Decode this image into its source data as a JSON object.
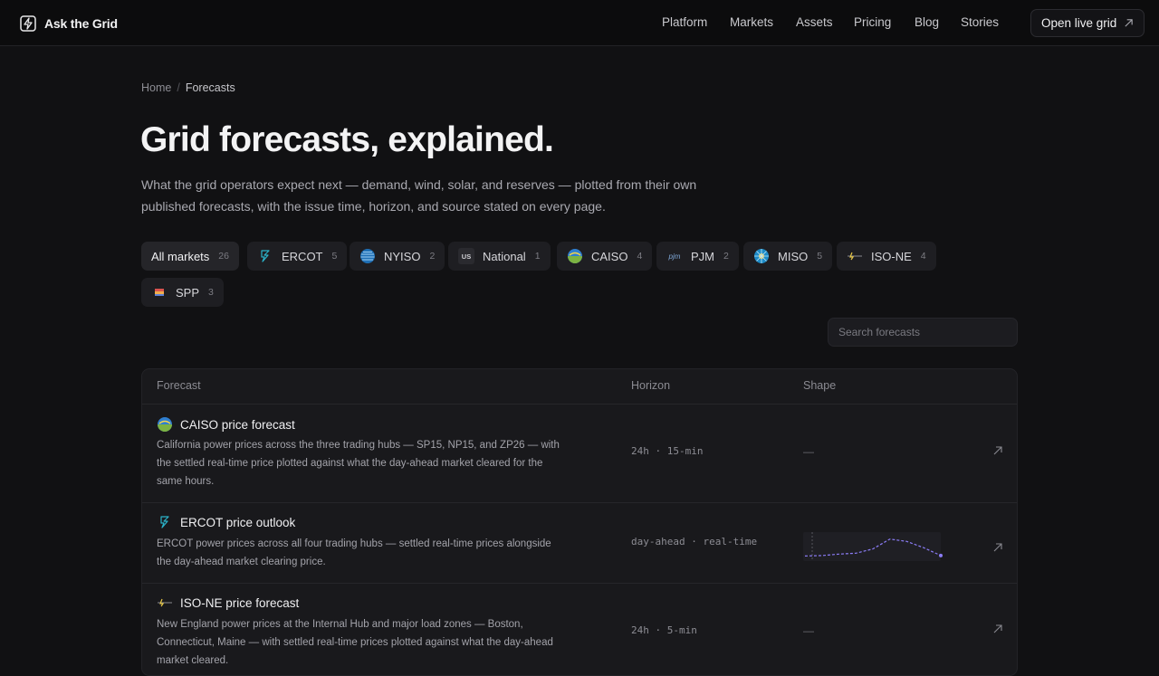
{
  "brand": {
    "name": "Ask the Grid",
    "logo_icon": "bolt-slash-logo-icon"
  },
  "nav": {
    "items": [
      "Platform",
      "Markets",
      "Assets",
      "Pricing",
      "Blog",
      "Stories"
    ],
    "cta_label": "Open live grid",
    "cta_icon": "arrow-up-right-icon"
  },
  "breadcrumb": {
    "home": "Home",
    "separator": "/",
    "current": "Forecasts"
  },
  "hero": {
    "title": "Grid forecasts, explained.",
    "subtitle": "What the grid operators expect next — demand, wind, solar, and reserves — plotted from their own published forecasts, with the issue time, horizon, and source stated on every page."
  },
  "filters": [
    {
      "label": "All markets",
      "count": "26",
      "icon": "",
      "active": true
    },
    {
      "label": "ERCOT",
      "count": "5",
      "icon": "ercot-icon"
    },
    {
      "label": "NYISO",
      "count": "2",
      "icon": "nyiso-icon"
    },
    {
      "label": "National",
      "count": "1",
      "icon": "us-flag-icon",
      "icon_text": "US"
    },
    {
      "label": "CAISO",
      "count": "4",
      "icon": "caiso-icon"
    },
    {
      "label": "PJM",
      "count": "2",
      "icon": "pjm-icon",
      "icon_text": "pjm"
    },
    {
      "label": "MISO",
      "count": "5",
      "icon": "miso-icon"
    },
    {
      "label": "ISO-NE",
      "count": "4",
      "icon": "isone-icon"
    },
    {
      "label": "SPP",
      "count": "3",
      "icon": "spp-icon"
    }
  ],
  "search": {
    "placeholder": "Search forecasts",
    "value": ""
  },
  "table": {
    "columns": [
      "Forecast",
      "Horizon",
      "Shape"
    ],
    "rows": [
      {
        "title": "CAISO price forecast",
        "icon": "caiso-icon",
        "description": "California power prices across the three trading hubs — SP15, NP15, and ZP26 — with the settled real-time price plotted against what the day-ahead market cleared for the same hours.",
        "horizon": "24h · 15-min",
        "shape": "—"
      },
      {
        "title": "ERCOT price outlook",
        "icon": "ercot-icon",
        "description": "ERCOT power prices across all four trading hubs — settled real-time prices alongside the day-ahead market clearing price.",
        "horizon": "day-ahead · real-time",
        "shape": "sparkline",
        "shape_points": [
          0.1,
          0.12,
          0.18,
          0.22,
          0.4,
          0.82,
          0.72,
          0.45,
          0.12
        ]
      },
      {
        "title": "ISO-NE price forecast",
        "icon": "isone-icon",
        "description": "New England power prices at the Internal Hub and major load zones — Boston, Connecticut, Maine — with settled real-time prices plotted against what the day-ahead market cleared.",
        "horizon": "24h · 5-min",
        "shape": "—"
      }
    ]
  },
  "colors": {
    "background": "#111113",
    "accent": "#8b7cf6",
    "ercot": "#2bb3c9",
    "caiso_green": "#7cb342",
    "caiso_blue": "#2f7fd0"
  }
}
